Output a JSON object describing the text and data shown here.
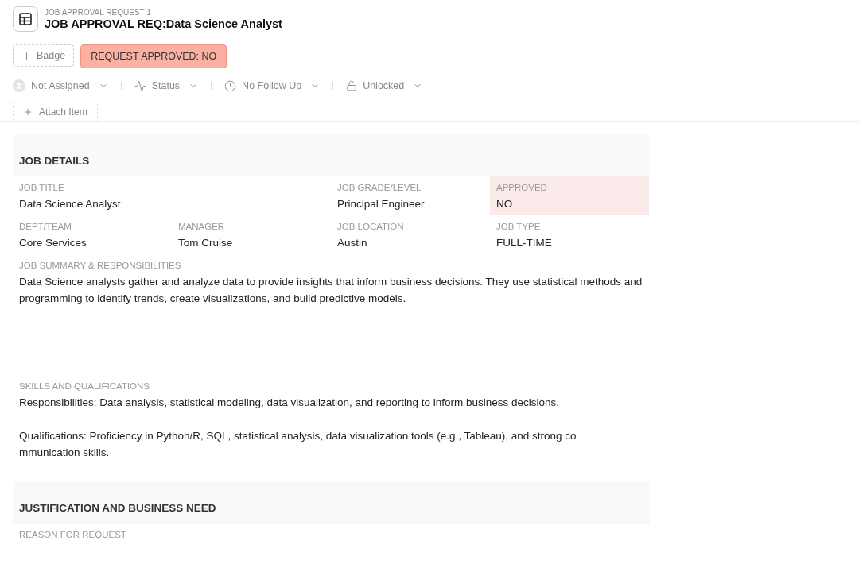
{
  "header": {
    "kicker": "JOB APPROVAL REQUEST 1",
    "title": "JOB APPROVAL REQ:Data Science Analyst"
  },
  "badges": [
    {
      "kind": "add",
      "label": "Badge"
    },
    {
      "kind": "status",
      "label": "REQUEST APPROVED: NO",
      "color": "#fbb1a1"
    }
  ],
  "toolbar": [
    {
      "kind": "avatar",
      "label": "Not Assigned"
    },
    {
      "kind": "status",
      "label": "Status"
    },
    {
      "kind": "clock",
      "label": "No Follow Up"
    },
    {
      "kind": "lock",
      "label": "Unlocked"
    }
  ],
  "attach": {
    "label": "Attach Item"
  },
  "sections": [
    {
      "title": "JOB DETAILS",
      "fields": [
        {
          "kind": "wide",
          "label": "JOB TITLE",
          "value": [
            "Data Science Analyst"
          ],
          "highlighted": false
        },
        {
          "kind": "short",
          "label": "JOB GRADE/LEVEL",
          "value": [
            "Principal Engineer"
          ],
          "highlighted": false
        },
        {
          "kind": "short",
          "label": "APPROVED",
          "value": [
            "NO"
          ],
          "highlighted": true
        },
        {
          "kind": "short",
          "label": "DEPT/TEAM",
          "value": [
            "Core Services"
          ],
          "highlighted": false
        },
        {
          "kind": "short",
          "label": "MANAGER",
          "value": [
            "Tom Cruise"
          ],
          "highlighted": false
        },
        {
          "kind": "short",
          "label": "JOB LOCATION",
          "value": [
            "Austin"
          ],
          "highlighted": false
        },
        {
          "kind": "short",
          "label": "JOB TYPE",
          "value": [
            "FULL-TIME"
          ],
          "highlighted": false
        },
        {
          "kind": "text",
          "label": "JOB SUMMARY & RESPONSIBILITIES",
          "value": [
            "Data Science analysts gather and analyze data to provide insights that inform business decisions. They use statistical methods and programming to identify trends, create visualizations, and build predictive models."
          ],
          "highlighted": false
        },
        {
          "kind": "text",
          "label": "SKILLS AND QUALIFICATIONS",
          "value": [
            "Responsibilities: Data analysis, statistical modeling, data visualization, and reporting to inform business decisions.",
            "Qualifications: Proficiency in Python/R, SQL, statistical analysis, data visualization tools (e.g., Tableau), and strong co",
            "mmunication skills."
          ],
          "highlighted": false
        }
      ]
    },
    {
      "title": "JUSTIFICATION AND BUSINESS NEED",
      "fields": [
        {
          "kind": "wide",
          "label": "REASON FOR REQUEST",
          "highlighted": false
        }
      ]
    }
  ]
}
